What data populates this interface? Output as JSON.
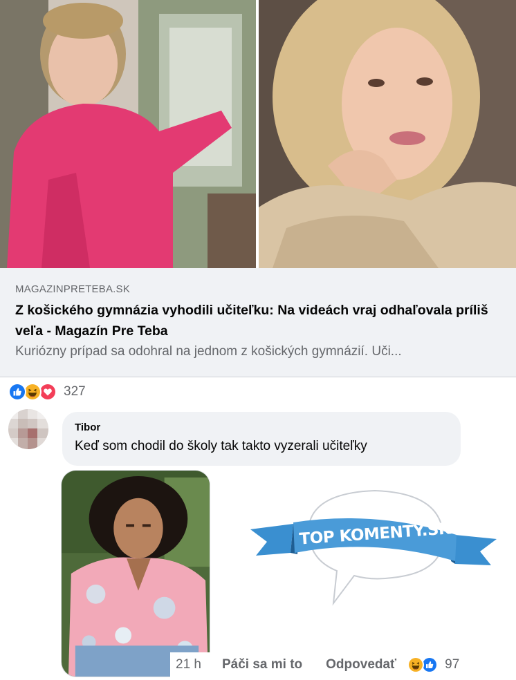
{
  "link": {
    "domain": "MAGAZINPRETEBA.SK",
    "title": "Z košického gymnázia vyhodili učiteľku: Na videách vraj odhaľovala príliš veľa - Magazín Pre Teba",
    "description": "Kuriózny prípad sa odohral na jednom z košických gymnázií. Uči..."
  },
  "post_reactions": {
    "icons": [
      "like-icon",
      "haha-icon",
      "love-icon"
    ],
    "count": "327"
  },
  "comment": {
    "author": "Tibor",
    "text": "Keď som chodil do školy tak takto vyzerali učiteľky",
    "time": "21 h",
    "like_label": "Páči sa mi to",
    "reply_label": "Odpovedať",
    "reaction_icons": [
      "haha-icon",
      "like-icon"
    ],
    "reaction_count": "97"
  },
  "watermark": {
    "text": "TOP KOMENTY.SK"
  },
  "colors": {
    "like_blue": "#1877f2",
    "love_red": "#f33e58",
    "haha_yellow": "#f7b125",
    "bubble_bg": "#f0f2f5",
    "secondary_text": "#65676b",
    "ribbon_blue": "#3a8fd0"
  }
}
